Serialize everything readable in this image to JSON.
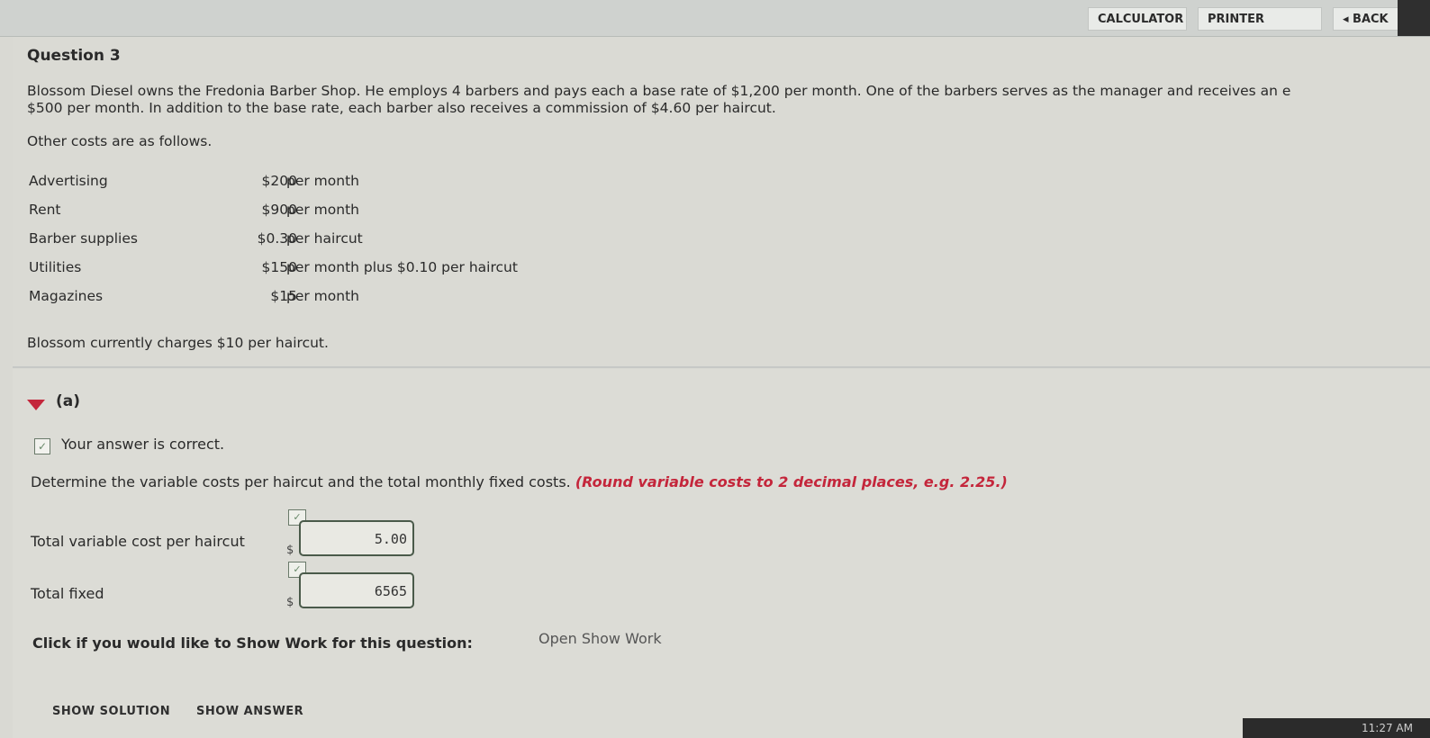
{
  "toolbar": {
    "calculator": "CALCULATOR",
    "printer_version": "PRINTER VERSION",
    "back": "◂ BACK"
  },
  "question": {
    "title": "Question 3",
    "intro_line1": "Blossom Diesel owns the Fredonia Barber Shop. He employs 4 barbers and pays each a base rate of $1,200 per month. One of the barbers serves as the manager and receives an e",
    "intro_line2": "$500 per month. In addition to the base rate, each barber also receives a commission of $4.60 per haircut.",
    "other_costs_text": "Other costs are as follows.",
    "costs": [
      {
        "label": "Advertising",
        "amount": "$200",
        "unit": "per month"
      },
      {
        "label": "Rent",
        "amount": "$900",
        "unit": "per month"
      },
      {
        "label": "Barber supplies",
        "amount": "$0.30",
        "unit": "per haircut"
      },
      {
        "label": "Utilities",
        "amount": "$150",
        "unit": "per month plus $0.10 per haircut"
      },
      {
        "label": "Magazines",
        "amount": "$15",
        "unit": "per month"
      }
    ],
    "charge_text": "Blossom currently charges $10 per haircut."
  },
  "part_a": {
    "label": "(a)",
    "status": "Your answer is correct.",
    "instruction": "Determine the variable costs per haircut and the total monthly fixed costs.",
    "hint": "(Round variable costs to 2 decimal places, e.g. 2.25.)",
    "fields": [
      {
        "label": "Total variable cost per haircut",
        "currency": "$",
        "value": "5.00"
      },
      {
        "label": "Total fixed",
        "currency": "$",
        "value": "6565"
      }
    ],
    "show_work_question": "Click if you would like to Show Work for this question:",
    "show_work_link": "Open Show Work"
  },
  "footer": {
    "show_solution": "SHOW SOLUTION",
    "show_answer": "SHOW ANSWER",
    "clock": "11:27 AM"
  },
  "colors": {
    "accent_red": "#c4263b",
    "background": "#dcdcd6"
  }
}
